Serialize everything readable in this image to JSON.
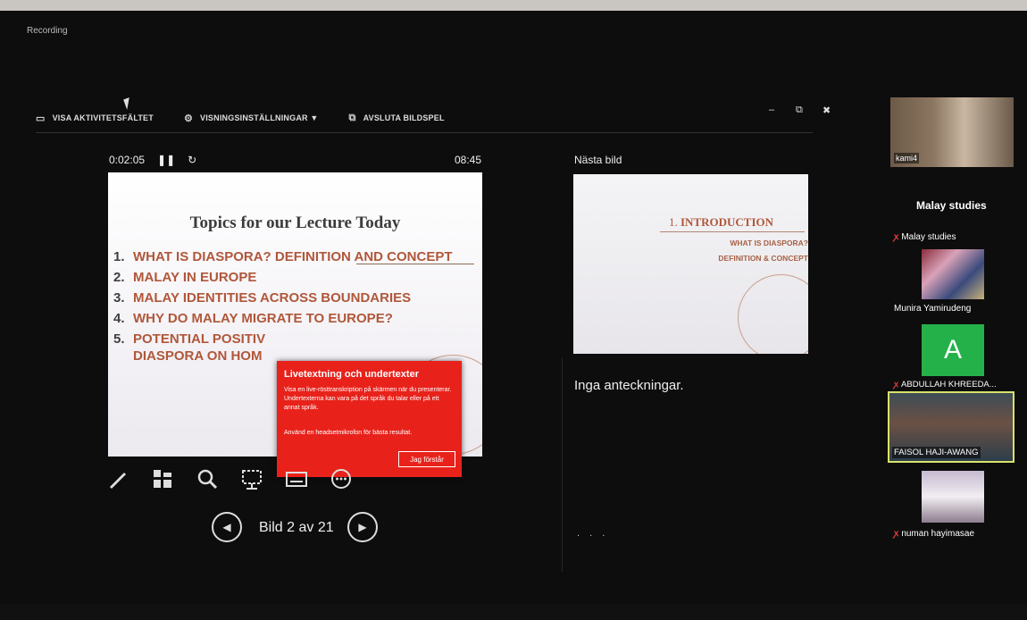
{
  "window": {
    "recording_label": "Recording"
  },
  "toolbar": {
    "show_taskbar": "VISA AKTIVITETSFÄLTET",
    "display_settings": "VISNINGSINSTÄLLNINGAR ▼",
    "end_slideshow": "AVSLUTA BILDSPEL",
    "minimize": "–",
    "restore": "⧉",
    "close": "✖"
  },
  "presenter": {
    "elapsed": "0:02:05",
    "clock": "08:45",
    "next_slide_label": "Nästa bild",
    "notes_text": "Inga anteckningar.",
    "slide_counter": "Bild 2 av 21"
  },
  "current_slide": {
    "title": "Topics for our Lecture Today",
    "items": [
      {
        "num": "1.",
        "text": "WHAT IS DIASPORA? DEFINITION AND CONCEPT"
      },
      {
        "num": "2.",
        "text": "MALAY IN EUROPE"
      },
      {
        "num": "3.",
        "text": "MALAY IDENTITIES ACROSS BOUNDARIES"
      },
      {
        "num": "4.",
        "text": "WHY DO MALAY MIGRATE TO EUROPE?"
      },
      {
        "num": "5.",
        "text": "POTENTIAL POSITIV"
      },
      {
        "num": "",
        "text": "DIASPORA ON HOM"
      }
    ]
  },
  "next_slide": {
    "title_num": "1.",
    "title": "INTRODUCTION",
    "sub1": "WHAT IS DIASPORA?",
    "sub2": "DEFINITION & CONCEPT"
  },
  "popup": {
    "title": "Livetextning och undertexter",
    "body": "Visa en live-rösttranskription på skärmen när du presenterar. Undertexterna kan vara på det språk du talar eller på ett annat språk.",
    "body2": "Använd en headsetmikrofon för bästa resultat.",
    "button": "Jag förstår"
  },
  "participants": {
    "panel_title": "Malay studies",
    "list": [
      {
        "name": "kami4",
        "muted": false
      },
      {
        "name": "Malay studies",
        "muted": true
      },
      {
        "name": "Munira Yamirudeng",
        "muted": false
      },
      {
        "name": "ABDULLAH KHREEDA...",
        "muted": true,
        "avatar_letter": "A"
      },
      {
        "name": "FAISOL HAJI-AWANG",
        "muted": false
      },
      {
        "name": "numan hayimasae",
        "muted": true
      }
    ]
  },
  "colors": {
    "slide_accent": "#b0573a",
    "popup_bg": "#e8221b",
    "avatar_green": "#25b14a",
    "active_speaker_border": "#d8e36a"
  },
  "icons": [
    "pen-icon",
    "all-slides-icon",
    "zoom-icon",
    "pointer-icon",
    "subtitles-icon",
    "more-icon",
    "prev-icon",
    "next-icon"
  ]
}
